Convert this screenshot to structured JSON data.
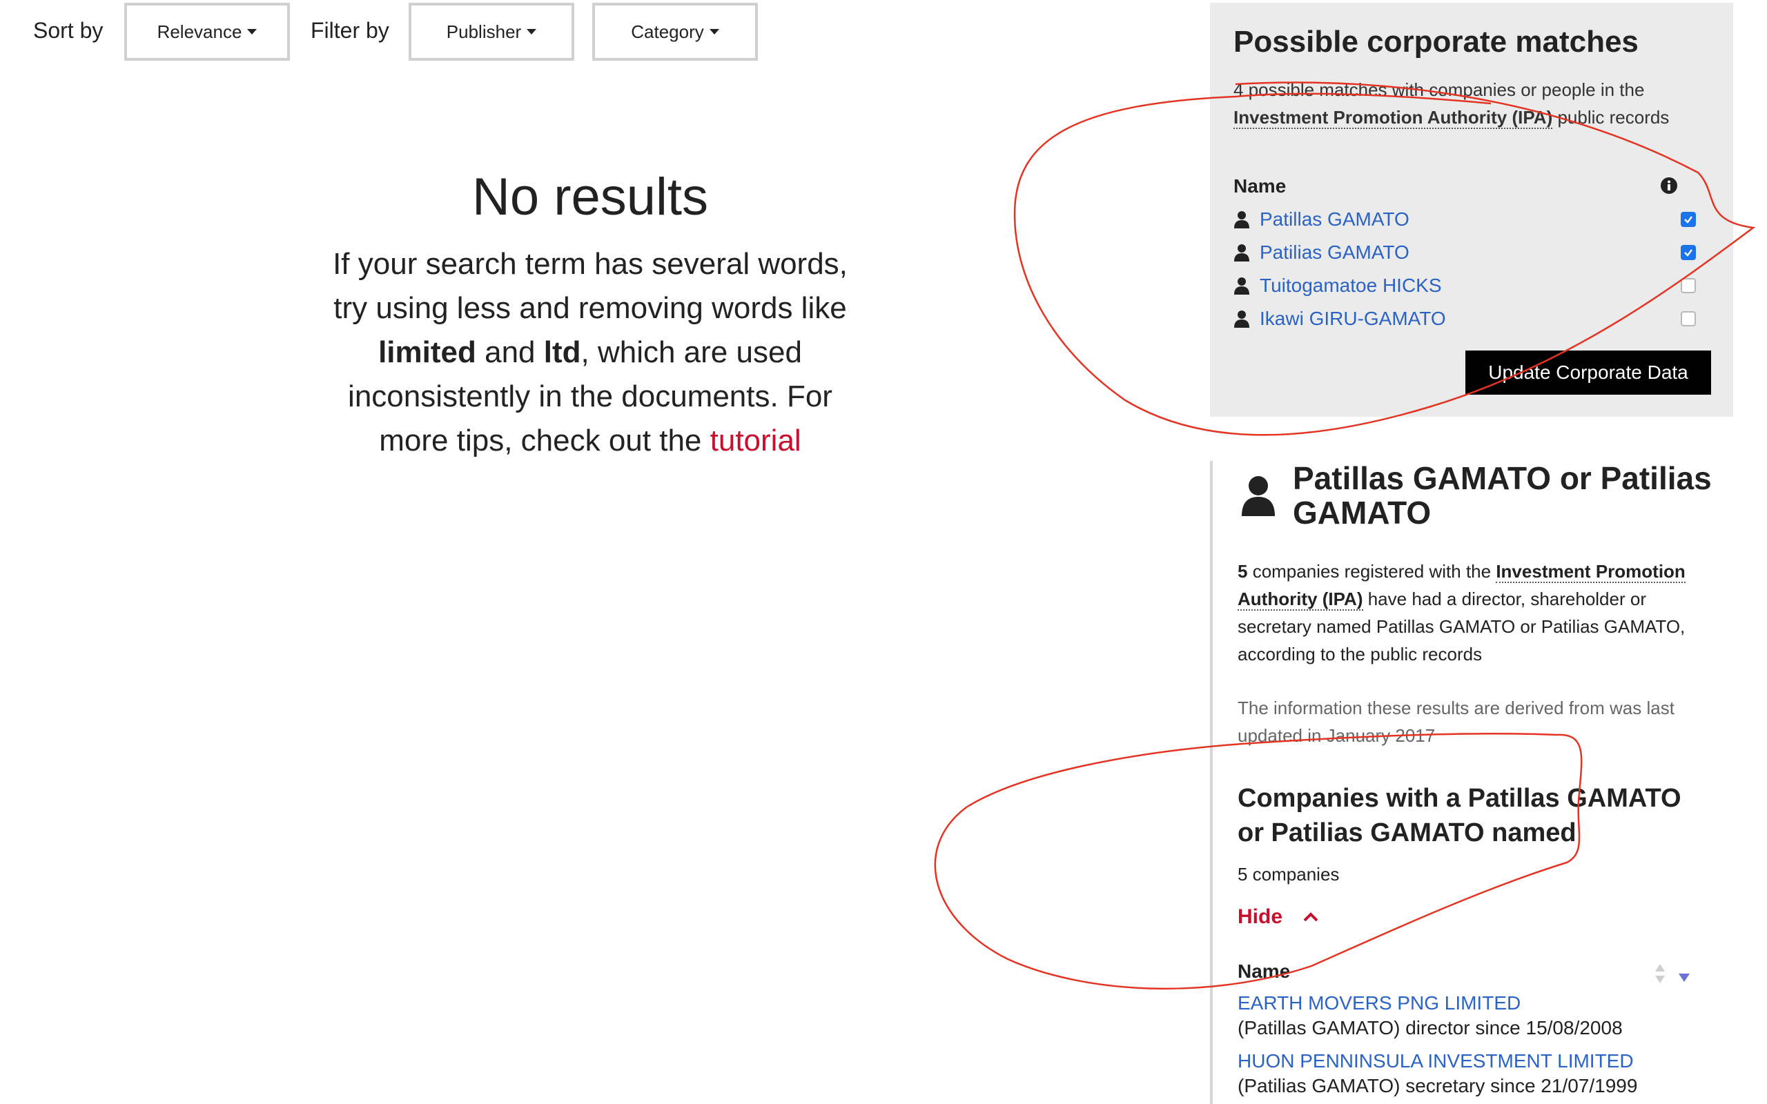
{
  "toolbar": {
    "sort_label": "Sort by",
    "sort_value": "Relevance",
    "filter_label": "Filter by",
    "publisher_value": "Publisher",
    "category_value": "Category"
  },
  "no_results": {
    "title": "No results",
    "text_1": "If your search term has several words, try using less and removing words like ",
    "bold_1": "limited",
    "text_2": " and ",
    "bold_2": "ltd",
    "text_3": ", which are used inconsistently in the documents. For more tips, check out the ",
    "link": "tutorial"
  },
  "matches": {
    "title": "Possible corporate matches",
    "subtitle_pre": "4 possible matches with companies or people in the ",
    "authority": "Investment Promotion Authority (IPA)",
    "subtitle_post": " public records",
    "name_header": "Name",
    "items": [
      {
        "name": "Patillas GAMATO",
        "checked": true
      },
      {
        "name": "Patilias GAMATO",
        "checked": true
      },
      {
        "name": "Tuitogamatoe HICKS",
        "checked": false
      },
      {
        "name": "Ikawi GIRU-GAMATO",
        "checked": false
      }
    ],
    "update_button": "Update Corporate Data"
  },
  "detail": {
    "title": "Patillas GAMATO or Patilias GAMATO",
    "count_bold": "5",
    "text_a": " companies registered with the ",
    "authority": "Investment Promotion Authority (IPA)",
    "text_b": " have had a director, shareholder or secretary named Patillas GAMATO or Patilias GAMATO, according to the public records",
    "updated": "The information these results are derived from was last updated in January 2017",
    "companies_heading": "Companies with a Patillas GAMATO or Patilias GAMATO named",
    "companies_count": "5 companies",
    "hide_label": "Hide",
    "table_header": "Name",
    "companies": [
      {
        "name": "EARTH MOVERS PNG LIMITED",
        "role": "(Patillas GAMATO) director since 15/08/2008"
      },
      {
        "name": "HUON PENNINSULA INVESTMENT LIMITED",
        "role": "(Patilias GAMATO) secretary since 21/07/1999"
      }
    ]
  },
  "colors": {
    "link_blue": "#2a63c6",
    "accent_red": "#c8102e",
    "panel_gray": "#ebebeb",
    "checkbox_blue": "#1a73e8",
    "scribble_red": "#e53322"
  }
}
